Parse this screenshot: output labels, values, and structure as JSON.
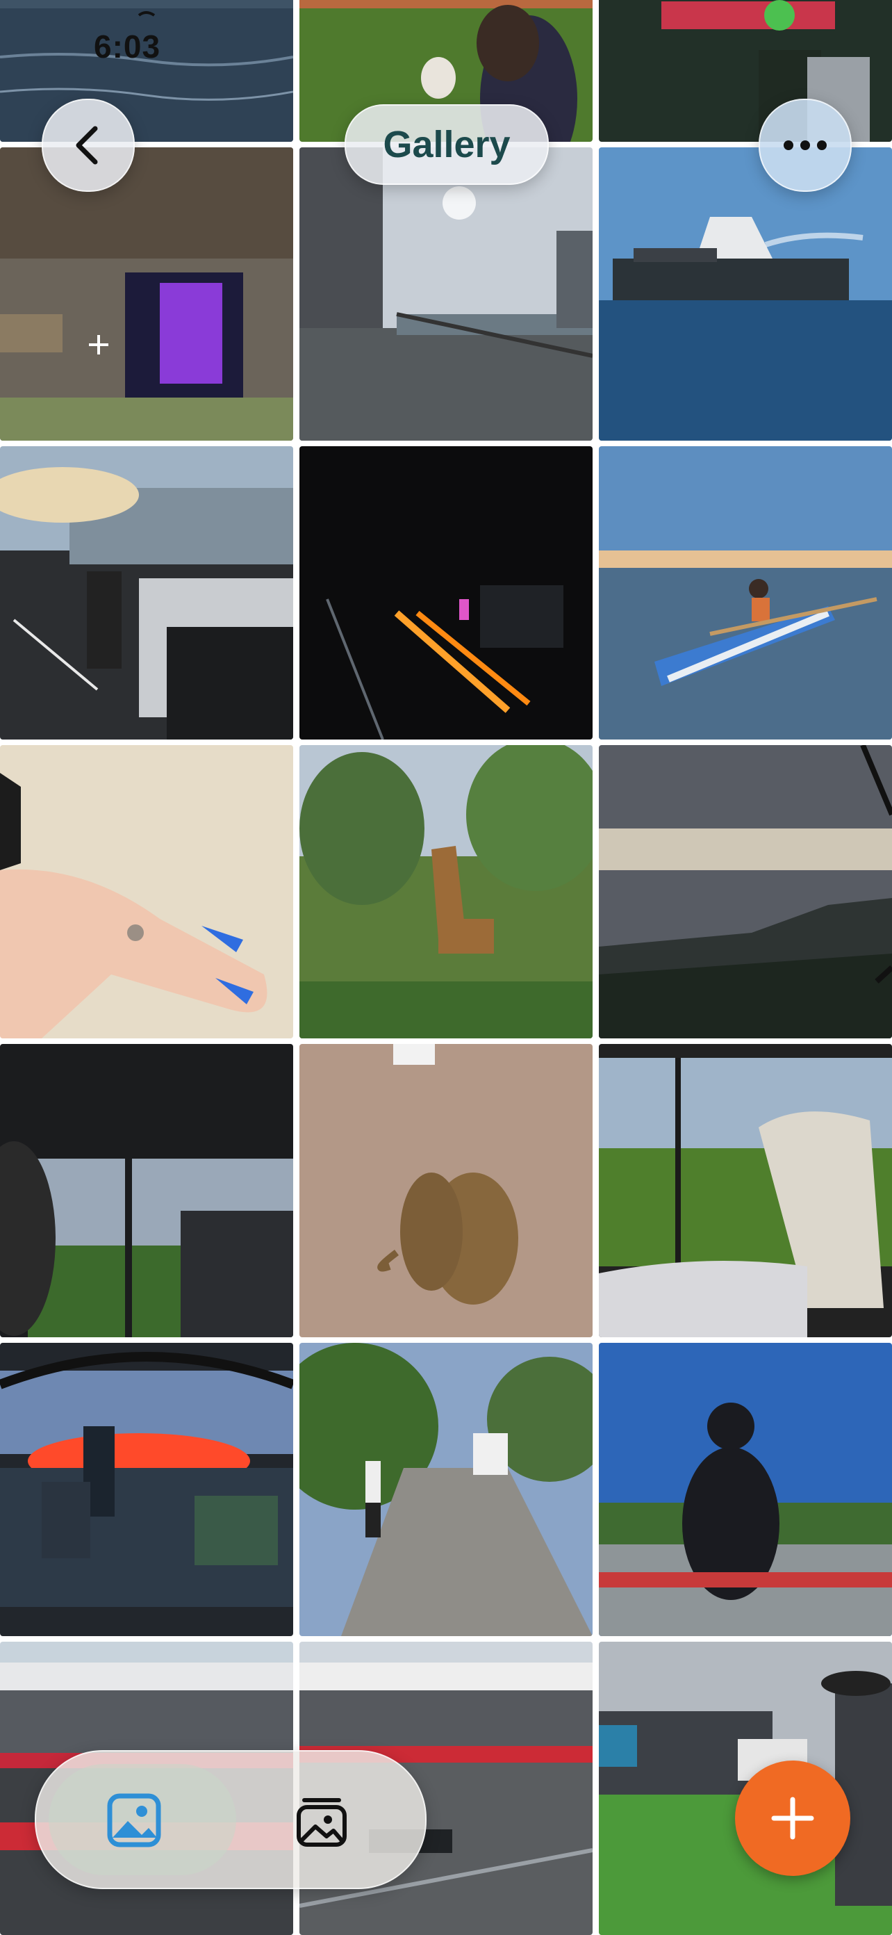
{
  "status_bar": {
    "time": "6:03"
  },
  "header": {
    "title": "Gallery",
    "back_icon": "chevron-left-icon",
    "more_icon": "ellipsis-icon"
  },
  "photos": [
    "photo-lake-swan",
    "photo-grass-person",
    "photo-stadium-crowd",
    "photo-minecraft-portal",
    "photo-balcony-view",
    "photo-harbor-ship",
    "photo-street-car",
    "photo-night-city",
    "photo-kayak",
    "photo-hand-ring",
    "photo-giraffe",
    "photo-mountain-sunset",
    "photo-safari-window",
    "photo-monkeys",
    "photo-safari-seat",
    "photo-city-sunset",
    "photo-street-walk",
    "photo-racetrack-person",
    "photo-grandstand",
    "photo-f1-track",
    "photo-paddock-grass"
  ],
  "tabbar": {
    "photos_icon": "photo-icon",
    "albums_icon": "albums-icon"
  },
  "fab": {
    "icon": "plus-icon"
  },
  "colors": {
    "accent": "#f06a23",
    "title": "#1c4a4c"
  }
}
